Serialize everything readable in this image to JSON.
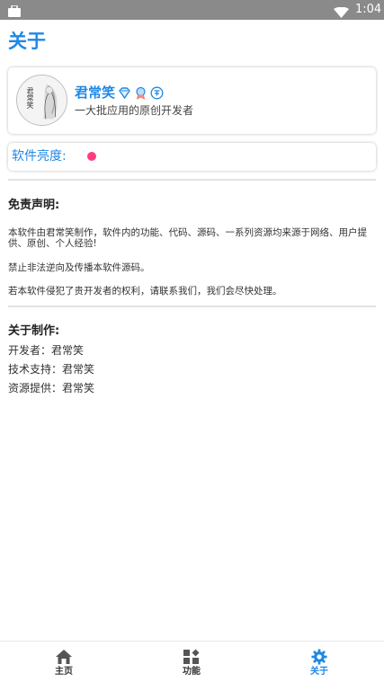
{
  "status_bar": {
    "time": "1:04"
  },
  "page_title": "关于",
  "profile": {
    "name": "君常笑",
    "bio": "一大批应用的原创开发者",
    "avatar_calligraphy": "君常笑"
  },
  "brightness": {
    "label": "软件亮度:",
    "dot_color": "#ff3d7f"
  },
  "disclaimer": {
    "title": "免责声明:",
    "paragraphs": [
      "本软件由君常笑制作，软件内的功能、代码、源码、一系列资源均来源于网络、用户提供、原创、个人经验!",
      "禁止非法逆向及传播本软件源码。",
      "若本软件侵犯了贵开发者的权利，请联系我们，我们会尽快处理。"
    ]
  },
  "about": {
    "title": "关于制作:",
    "lines": [
      "开发者：君常笑",
      "技术支持：君常笑",
      "资源提供：君常笑"
    ]
  },
  "bottom_nav": {
    "items": [
      {
        "label": "主页",
        "icon": "home-icon"
      },
      {
        "label": "功能",
        "icon": "grid-icon"
      },
      {
        "label": "关于",
        "icon": "gear-icon",
        "active": true
      }
    ]
  },
  "colors": {
    "accent": "#1e88e5",
    "status_bar": "#8a8a8a",
    "dot": "#ff3d7f"
  }
}
